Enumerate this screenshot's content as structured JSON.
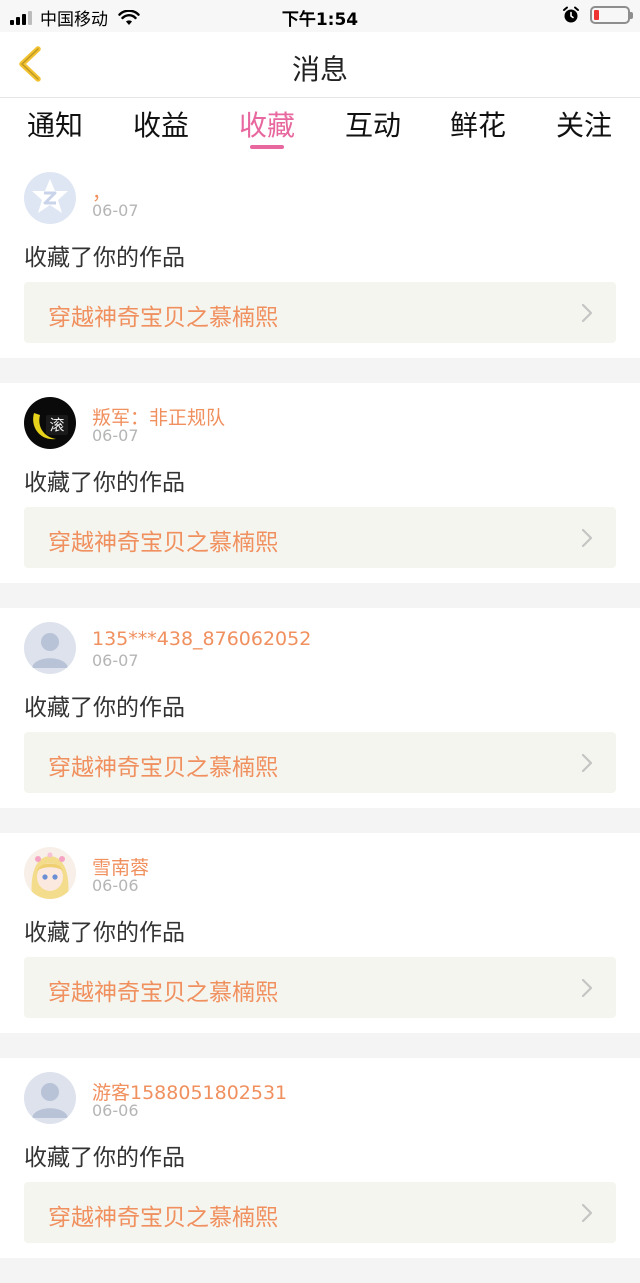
{
  "status_bar": {
    "carrier": "中国移动",
    "time": "下午1:54"
  },
  "nav": {
    "title": "消息"
  },
  "tabs": [
    {
      "label": "通知",
      "active": false
    },
    {
      "label": "收益",
      "active": false
    },
    {
      "label": "收藏",
      "active": true
    },
    {
      "label": "互动",
      "active": false
    },
    {
      "label": "鲜花",
      "active": false
    },
    {
      "label": "关注",
      "active": false
    }
  ],
  "colors": {
    "accent_pink": "#e7679e",
    "name_orange": "#f0905f",
    "card_bg": "#f5f5ef"
  },
  "messages": [
    {
      "avatar_icon": "qq-default-avatar-icon",
      "name": "，",
      "date": "06-07",
      "action": "收藏了你的作品",
      "work_title": "穿越神奇宝贝之慕楠熙"
    },
    {
      "avatar_icon": "dark-moon-avatar-icon",
      "avatar_text": "滚",
      "name": "叛军：非正规队",
      "date": "06-07",
      "action": "收藏了你的作品",
      "work_title": "穿越神奇宝贝之慕楠熙"
    },
    {
      "avatar_icon": "default-user-avatar-icon",
      "name": "135***438_876062052",
      "date": "06-07",
      "action": "收藏了你的作品",
      "work_title": "穿越神奇宝贝之慕楠熙"
    },
    {
      "avatar_icon": "anime-girl-avatar-icon",
      "name": "雪南蓉",
      "date": "06-06",
      "action": "收藏了你的作品",
      "work_title": "穿越神奇宝贝之慕楠熙"
    },
    {
      "avatar_icon": "default-user-avatar-icon",
      "name": "游客1588051802531",
      "date": "06-06",
      "action": "收藏了你的作品",
      "work_title": "穿越神奇宝贝之慕楠熙"
    }
  ]
}
